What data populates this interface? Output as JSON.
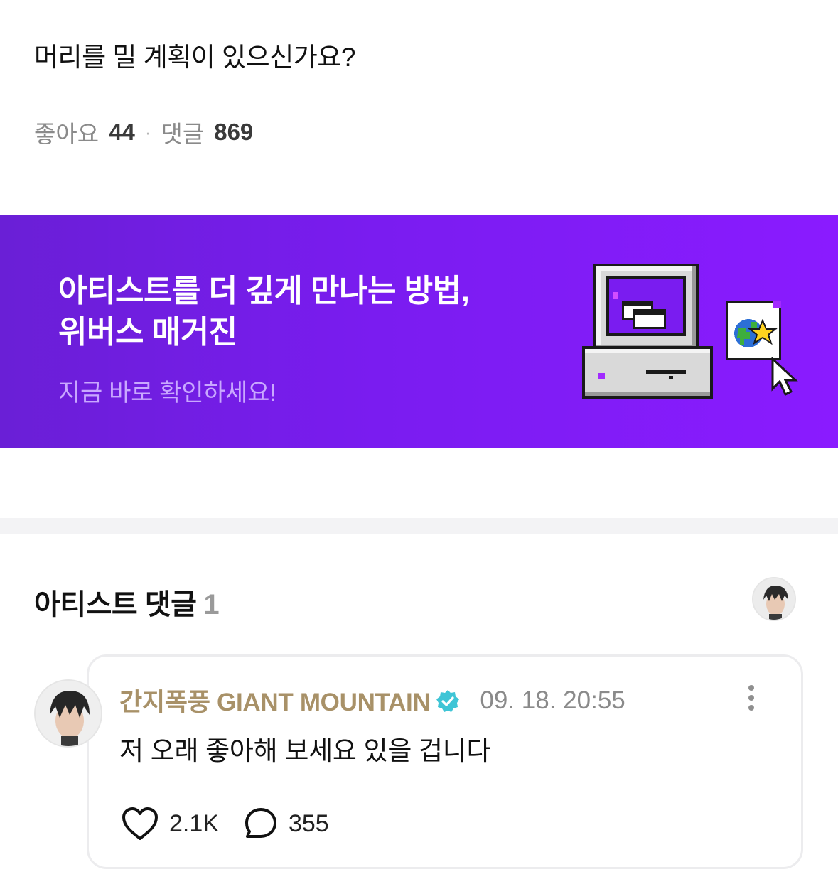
{
  "post": {
    "title": "머리를 밀 계획이 있으신가요?",
    "likes_label": "좋아요",
    "likes_count": "44",
    "separator": "·",
    "comments_label": "댓글",
    "comments_count": "869"
  },
  "banner": {
    "title": "아티스트를 더 깊게 만나는 방법,\n위버스 매거진",
    "subtitle": "지금 바로 확인하세요!",
    "background": "#7a1cf0",
    "illustration": "retro-computer-with-globe-window-and-cursor"
  },
  "artist_comments": {
    "title": "아티스트 댓글",
    "count": "1",
    "avatar_icon": "artist-avatar"
  },
  "comment": {
    "author": "간지폭풍 GIANT MOUNTAIN",
    "author_color": "#a89168",
    "verified_icon": "verified-badge-icon",
    "verified_color": "#3fc5d6",
    "timestamp": "09. 18. 20:55",
    "text": "저 오래 좋아해 보세요 있을 겁니다",
    "like_count": "2.1K",
    "reply_count": "355",
    "like_icon": "heart-icon",
    "reply_icon": "speech-bubble-icon",
    "more_icon": "more-vertical-icon"
  }
}
